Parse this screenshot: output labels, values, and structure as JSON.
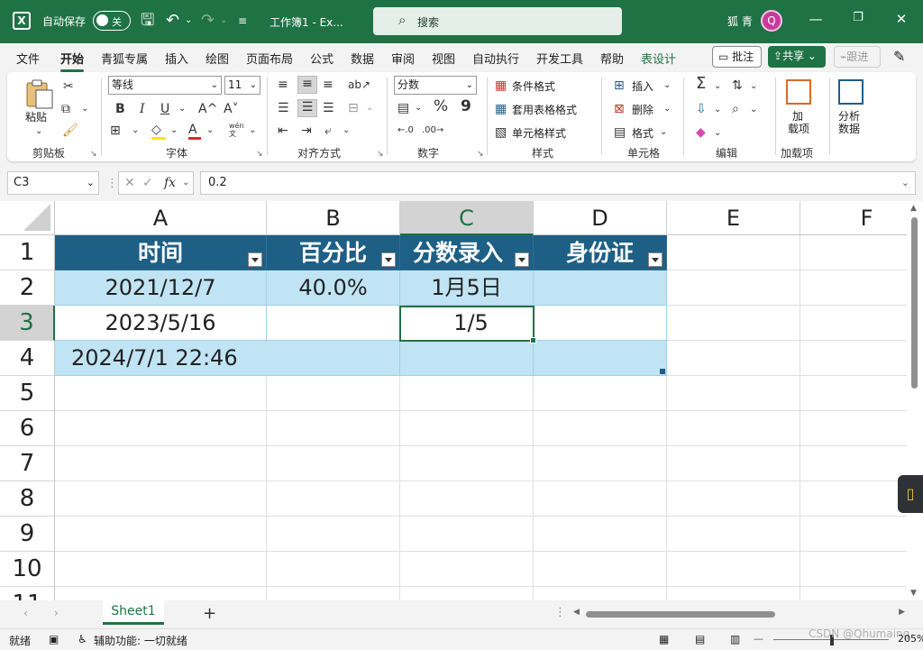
{
  "titlebar": {
    "autosave_label": "自动保存",
    "autosave_state": "关",
    "doc_title": "工作簿1  -  Ex...",
    "search_placeholder": "搜索",
    "user_name": "狐 青",
    "avatar_initial": "Q",
    "brand_color": "#1f7244"
  },
  "menu": {
    "items": [
      "文件",
      "开始",
      "青狐专属",
      "插入",
      "绘图",
      "页面布局",
      "公式",
      "数据",
      "审阅",
      "视图",
      "自动执行",
      "开发工具",
      "帮助",
      "表设计"
    ],
    "active": "开始",
    "comment_label": "批注",
    "share_label": "共享",
    "follow_label": "跟进"
  },
  "ribbon": {
    "paste_label": "粘贴",
    "clipboard_label": "剪贴板",
    "font_name": "等线",
    "font_size": "11",
    "font_label": "字体",
    "bold": "B",
    "italic": "I",
    "underline": "U",
    "grow_font": "A^",
    "shrink_font": "A˅",
    "font_color_glyph": "A",
    "phonetic_top": "wén",
    "phonetic_bottom": "文",
    "align_label": "对齐方式",
    "number_format": "分数",
    "number_label": "数字",
    "percent": "%",
    "comma": "9",
    "cond_format": "条件格式",
    "table_format": "套用表格格式",
    "cell_style": "单元格样式",
    "styles_label": "样式",
    "insert": "插入",
    "delete": "删除",
    "format": "格式",
    "cells_label": "单元格",
    "editing_label": "编辑",
    "addins_top": "加",
    "addins_bottom": "载项",
    "addins_label": "加载项",
    "analyze_top": "分析",
    "analyze_bottom": "数据"
  },
  "formula": {
    "name_box": "C3",
    "fx": "fx",
    "value": "0.2"
  },
  "grid": {
    "columns": [
      "A",
      "B",
      "C",
      "D",
      "E",
      "F"
    ],
    "rows": [
      "1",
      "2",
      "3",
      "4",
      "5",
      "6",
      "7",
      "8",
      "9",
      "10",
      "11"
    ],
    "table_headers": [
      "时间",
      "百分比",
      "分数录入",
      "身份证"
    ],
    "row2": [
      "2021/12/7",
      "40.0%",
      "1月5日",
      ""
    ],
    "row3": [
      "2023/5/16",
      "",
      "1/5",
      ""
    ],
    "row4": [
      "2024/7/1 22:46",
      "",
      "",
      ""
    ]
  },
  "sheets": {
    "tabs": [
      "Sheet1"
    ],
    "add": "+"
  },
  "status": {
    "ready": "就绪",
    "accessibility": "辅助功能: 一切就绪",
    "zoom": "205%",
    "watermark": "CSDN @Qhumaing"
  }
}
